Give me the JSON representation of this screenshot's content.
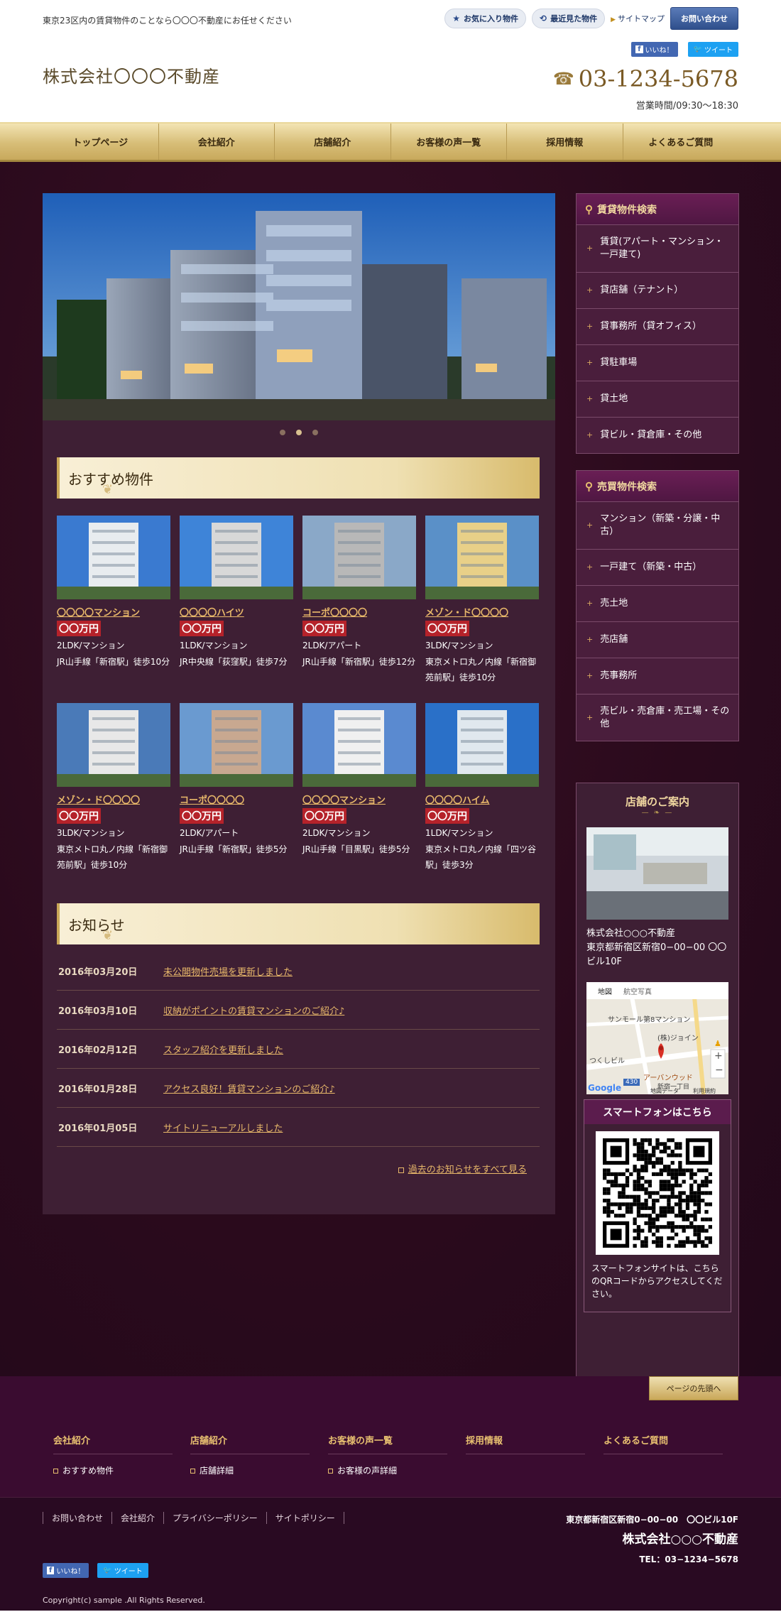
{
  "header": {
    "tagline": "東京23区内の賃貸物件のことなら〇〇〇不動産にお任せください",
    "logo": "株式会社〇〇〇不動産",
    "favorites": "お気に入り物件",
    "recent": "最近見た物件",
    "sitemap": "サイトマップ",
    "contact": "お問い合わせ",
    "like": "いいね！",
    "tweet": "ツイート",
    "tel": "03-1234-5678",
    "hours": "営業時間/09:30〜18:30"
  },
  "nav": [
    "トップページ",
    "会社紹介",
    "店舗紹介",
    "お客様の声一覧",
    "採用情報",
    "よくあるご質問"
  ],
  "recommended": {
    "heading": "おすすめ物件",
    "items": [
      {
        "name": "〇〇〇〇マンション",
        "price": "〇〇万円",
        "type": "2LDK/マンション",
        "access": "JR山手線「新宿駅」徒歩10分"
      },
      {
        "name": "〇〇〇〇ハイツ",
        "price": "〇〇万円",
        "type": "1LDK/マンション",
        "access": "JR中央線「荻窪駅」徒歩7分"
      },
      {
        "name": "コーポ〇〇〇〇",
        "price": "〇〇万円",
        "type": "2LDK/アパート",
        "access": "JR山手線「新宿駅」徒歩12分"
      },
      {
        "name": "メゾン・ド〇〇〇〇",
        "price": "〇〇万円",
        "type": "3LDK/マンション",
        "access": "東京メトロ丸ノ内線「新宿御苑前駅」徒歩10分"
      },
      {
        "name": "メゾン・ド〇〇〇〇",
        "price": "〇〇万円",
        "type": "3LDK/マンション",
        "access": "東京メトロ丸ノ内線「新宿御苑前駅」徒歩10分"
      },
      {
        "name": "コーポ〇〇〇〇",
        "price": "〇〇万円",
        "type": "2LDK/アパート",
        "access": "JR山手線「新宿駅」徒歩5分"
      },
      {
        "name": "〇〇〇〇マンション",
        "price": "〇〇万円",
        "type": "2LDK/マンション",
        "access": "JR山手線「目黒駅」徒歩5分"
      },
      {
        "name": "〇〇〇〇ハイム",
        "price": "〇〇万円",
        "type": "1LDK/マンション",
        "access": "東京メトロ丸ノ内線「四ツ谷駅」徒歩3分"
      }
    ]
  },
  "news": {
    "heading": "お知らせ",
    "items": [
      {
        "date": "2016年03月20日",
        "title": "未公開物件売場を更新しました"
      },
      {
        "date": "2016年03月10日",
        "title": "収納がポイントの賃貸マンションのご紹介♪"
      },
      {
        "date": "2016年02月12日",
        "title": "スタッフ紹介を更新しました"
      },
      {
        "date": "2016年01月28日",
        "title": "アクセス良好！賃貸マンションのご紹介♪"
      },
      {
        "date": "2016年01月05日",
        "title": "サイトリニューアルしました"
      }
    ],
    "all": "過去のお知らせをすべて見る"
  },
  "rental_search": {
    "heading": "賃貸物件検索",
    "items": [
      "賃貸(アパート・マンション・一戸建て)",
      "貸店舗（テナント）",
      "貸事務所（貸オフィス）",
      "貸駐車場",
      "貸土地",
      "貸ビル・貸倉庫・その他"
    ]
  },
  "sale_search": {
    "heading": "売買物件検索",
    "items": [
      "マンション（新築・分譲・中古）",
      "一戸建て（新築・中古）",
      "売土地",
      "売店舗",
      "売事務所",
      "売ビル・売倉庫・売工場・その他"
    ]
  },
  "store": {
    "heading": "店舗のご案内",
    "name": "株式会社○○○不動産",
    "address": "東京都新宿区新宿0−00−00 〇〇ビル10F",
    "map": {
      "tab1": "地図",
      "tab2": "航空写真",
      "label1": "サンモール第8マンション",
      "label2": "(株)ジョイン",
      "label3": "つくしビル",
      "label4": "アーバンウッド",
      "label5": "新宿一丁目",
      "road": "430",
      "footer": "地図データ",
      "terms": "利用規約"
    },
    "smartphone_title": "スマートフォンはこちら",
    "smartphone_text": "スマートフォンサイトは、こちらのQRコードからアクセスしてください。"
  },
  "footer": {
    "totop": "ページの先頭へ",
    "cols": [
      {
        "title": "会社紹介",
        "link": "おすすめ物件"
      },
      {
        "title": "店舗紹介",
        "link": "店舗詳細"
      },
      {
        "title": "お客様の声一覧",
        "link": "お客様の声詳細"
      },
      {
        "title": "採用情報",
        "link": ""
      },
      {
        "title": "よくあるご質問",
        "link": ""
      }
    ],
    "links": [
      "お問い合わせ",
      "会社紹介",
      "プライバシーポリシー",
      "サイトポリシー"
    ],
    "address": "東京都新宿区新宿0−00−00　〇〇ビル10F",
    "company": "株式会社○○○不動産",
    "tel": "TEL：03−1234−5678",
    "like": "いいね！",
    "tweet": "ツイート",
    "copyright": "Copyright(c) sample .All Rights Reserved."
  },
  "colors": {
    "accent_gold": "#e8b86a",
    "price_red": "#b5222a",
    "brand_purple": "#3a0c30"
  }
}
